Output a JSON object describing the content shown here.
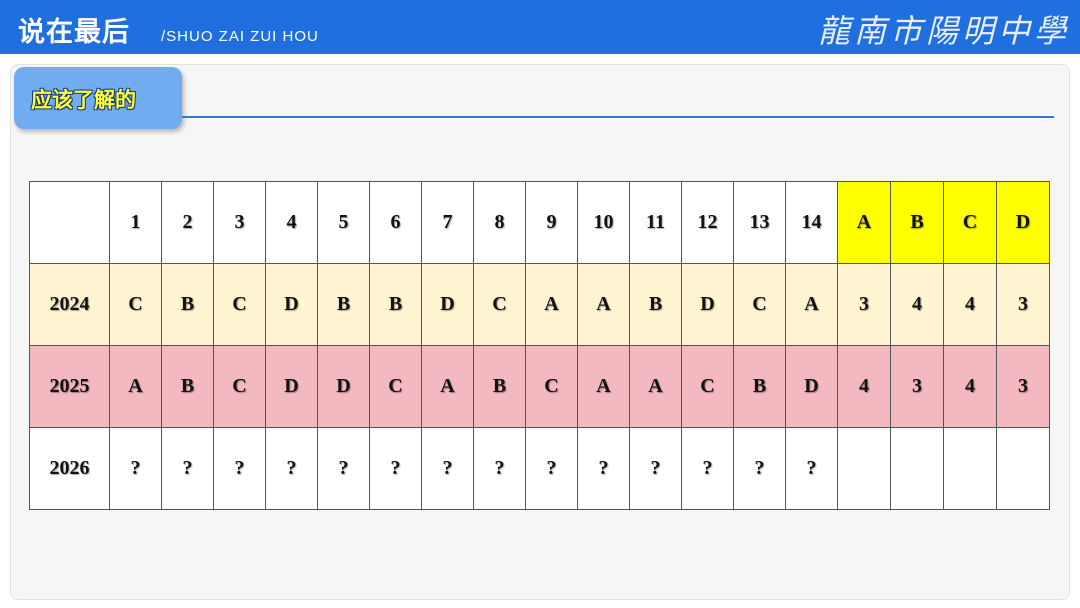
{
  "header": {
    "title": "说在最后",
    "subtitle": "/SHUO ZAI ZUI HOU",
    "school": "龍南市陽明中學"
  },
  "section": {
    "label": "应该了解的"
  },
  "table": {
    "question_numbers": [
      "1",
      "2",
      "3",
      "4",
      "5",
      "6",
      "7",
      "8",
      "9",
      "10",
      "11",
      "12",
      "13",
      "14"
    ],
    "options": [
      "A",
      "B",
      "C",
      "D"
    ],
    "rows": [
      {
        "year": "2024",
        "answers": [
          "C",
          "B",
          "C",
          "D",
          "B",
          "B",
          "D",
          "C",
          "A",
          "A",
          "B",
          "D",
          "C",
          "A"
        ],
        "counts": [
          "3",
          "4",
          "4",
          "3"
        ]
      },
      {
        "year": "2025",
        "answers": [
          "A",
          "B",
          "C",
          "D",
          "D",
          "C",
          "A",
          "B",
          "C",
          "A",
          "A",
          "C",
          "B",
          "D"
        ],
        "counts": [
          "4",
          "3",
          "4",
          "3"
        ]
      },
      {
        "year": "2026",
        "answers": [
          "?",
          "?",
          "?",
          "?",
          "?",
          "?",
          "?",
          "?",
          "?",
          "?",
          "?",
          "?",
          "?",
          "?"
        ],
        "counts": [
          "",
          "",
          "",
          ""
        ]
      }
    ]
  },
  "colors": {
    "topbar": "#1f6fe0",
    "option_header": "#ffff00",
    "row_2024": "#fff4d2",
    "row_2025": "#f4b8c0"
  }
}
